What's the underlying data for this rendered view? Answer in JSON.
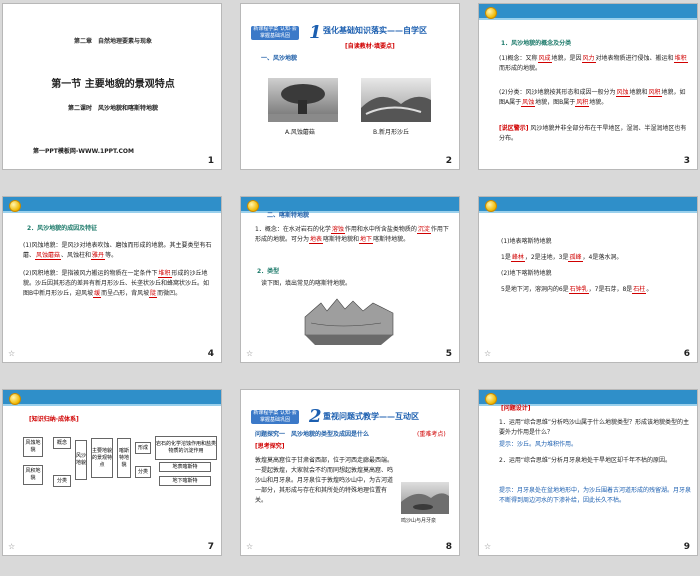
{
  "slides": [
    {
      "number": "1",
      "chapter": "第二章　自然地理要素与现象",
      "title": "第一节 主要地貌的景观特点",
      "subtitle": "第二课时　风沙地貌和喀斯特地貌",
      "footer": "第一PPT模板网-WWW.1PPT.COM"
    },
    {
      "number": "2",
      "badge": "新课程学案 认知·会掌握基础巩固",
      "section_num": "1",
      "heading": "强化基础知识落实——自学区",
      "tag": "[自读教材·填要点]",
      "subhead": "一、风沙地貌",
      "captions": [
        "A.风蚀蘑菇",
        "B.新月形沙丘"
      ]
    },
    {
      "number": "3",
      "heading": "1．风沙地貌的概念及分类",
      "p1a": "(1)概念：又称",
      "p1b": "地貌，是因",
      "p1c": "对地表物质进行侵蚀、搬运和",
      "p1d": "而形成的地貌。",
      "f1": "风成",
      "f2": "风力",
      "f3": "堆积",
      "p2a": "(2)分类：风沙地貌按其形态和成因一般分为",
      "p2b": "地貌和",
      "p2c": "地貌，如图A属于",
      "p2d": "地貌，图B属于",
      "p2e": "地貌。",
      "f4": "风蚀",
      "f5": "风积",
      "f6": "风蚀",
      "f7": "风积",
      "tip_tag": "[说区警示]",
      "tip": "风沙地貌并非全部分布在干旱地区，湿润、半湿润地区也有分布。"
    },
    {
      "number": "4",
      "heading": "2．风沙地貌的成因及特征",
      "p1a": "(1)风蚀地貌：是风沙对地表吹蚀、磨蚀而形成的地貌。其主要类型有石蘑、",
      "p1b": "、风蚀柱和",
      "p1c": "等。",
      "f1": "风蚀蘑菇",
      "f2": "雅丹",
      "p2a": "(2)风积地貌：是指被风力搬运的物质在一定条件下",
      "p2b": "形成的沙丘地貌。沙丘因其形态的差异有新月形沙丘、长垄状沙丘和蜂窝状沙丘。如图B中新月形沙丘，迎风坡",
      "p2c": "而呈凸形，背风坡",
      "p2d": "而微凹。",
      "f3": "堆积",
      "f4": "缓",
      "f5": "陡"
    },
    {
      "number": "5",
      "head": "二、喀斯特地貌",
      "p1a": "1．概念：在水对岩石的化学",
      "p1b": "作用和水中所含盐类物质的",
      "p1c": "作用下形成的地貌。可分为",
      "p1d": "喀斯特地貌和",
      "p1e": "喀斯特地貌。",
      "f1": "溶蚀",
      "f2": "沉淀",
      "f3": "地表",
      "f4": "地下",
      "p2": "2．类型",
      "p3": "读下图，填出常见的喀斯特地貌。"
    },
    {
      "number": "6",
      "p1": "(1)地表喀斯特地貌",
      "p2a": "1是",
      "p2b": "，2是洼地，3是",
      "p2c": "，4是落水洞。",
      "f1": "峰林",
      "f2": "孤峰",
      "p3": "(2)地下喀斯特地貌",
      "p4a": "5是地下河，溶洞内的6是",
      "p4b": "，7是石芽，8是",
      "p4c": "。",
      "f3": "石钟乳",
      "f4": "石柱"
    },
    {
      "number": "7",
      "tag": "[知识归纳·成体系]",
      "boxes": [
        "风蚀地貌",
        "风积地貌",
        "概念",
        "分类",
        "风沙地貌",
        "主要地貌的景观特点",
        "喀斯特地貌",
        "形成",
        "分类",
        "岩石的化学溶蚀作用和盐类物质的沉淀作用",
        "地表喀斯特",
        "地下喀斯特"
      ]
    },
    {
      "number": "8",
      "badge": "新课程学案 认知·会掌握基础巩固",
      "section_num": "2",
      "heading": "重视问题式教学——互动区",
      "explore": "问题探究一　风沙地貌的类型及成因是什么",
      "note": "(重难考点)",
      "tag": "[思考探究]",
      "body": "敦煌莫高窟位于甘肃省西部，位于河西走廊最西端。一提起敦煌，大家就会不约而同想起敦煌莫高窟、鸣沙山和月牙泉。月牙泉位于敦煌鸣沙山中，为古河道一部分，其形成与存在和其所处的特殊地理位置有关。",
      "caption": "鸣沙山与月牙泉"
    },
    {
      "number": "9",
      "tag": "[问题设计]",
      "q1": "1．运用“综合思维”分析鸣沙山属于什么地貌类型？形成该地貌类型的主要外力作用是什么？",
      "a1": "提示：沙丘。风力堆积作用。",
      "q2": "2．运用“综合思维”分析月牙泉地处干旱地区却千年不枯的原因。",
      "a2": "提示：月牙泉处在盆地地形中，为沙丘围着古河道形成的残留湖。月牙泉不断得到周边河水的下渗补给，因此长久不枯。"
    }
  ]
}
